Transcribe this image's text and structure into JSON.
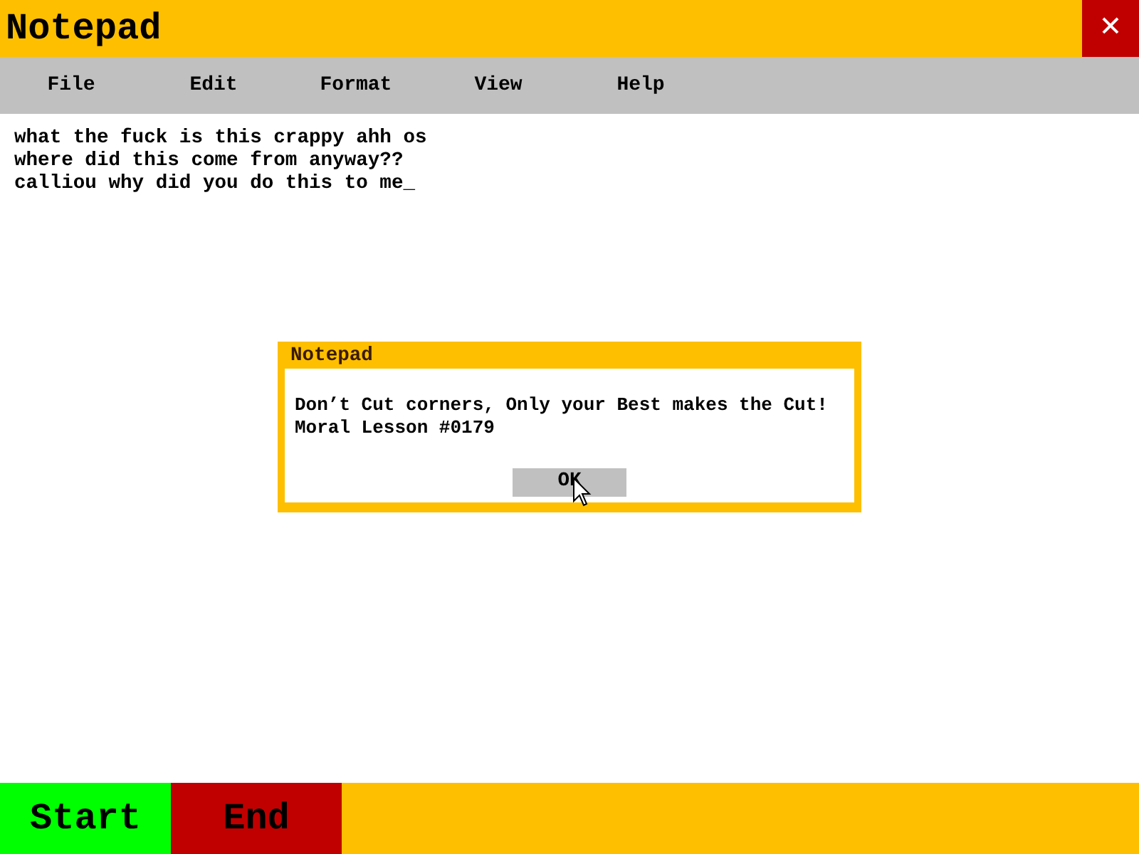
{
  "window": {
    "title": "Notepad",
    "close": "✕"
  },
  "menu": [
    "File",
    "Edit",
    "Format",
    "View",
    "Help"
  ],
  "editor": {
    "lines": [
      "what the fuck is this crappy ahh os",
      "where did this come from anyway??",
      "calliou why did you do this to me_"
    ]
  },
  "dialog": {
    "title": "Notepad",
    "message": [
      "Don’t Cut corners, Only your Best makes the Cut!",
      "Moral Lesson #0179"
    ],
    "button": "OK"
  },
  "taskbar": [
    {
      "label": "Start",
      "kind": "start"
    },
    {
      "label": "End",
      "kind": "end"
    }
  ]
}
